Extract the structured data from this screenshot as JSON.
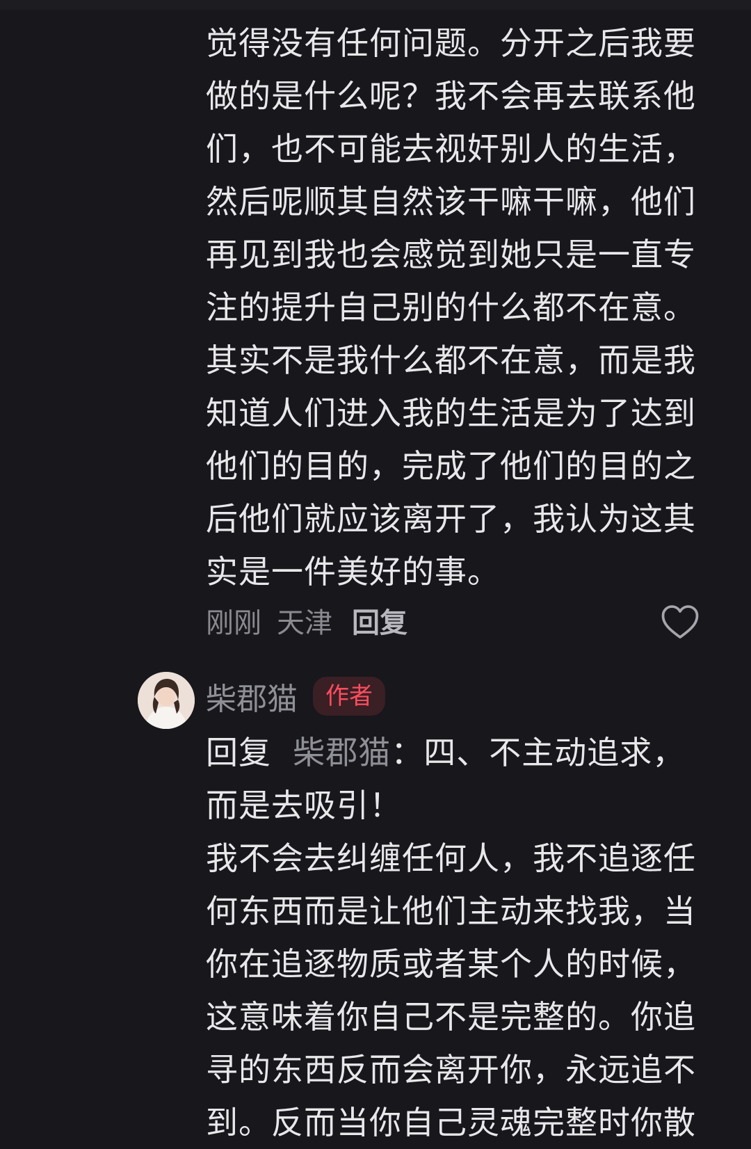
{
  "comment1": {
    "text": "觉得没有任何问题。分开之后我要做的是什么呢？我不会再去联系他们，也不可能去视奸别人的生活，然后呢顺其自然该干嘛干嘛，他们再见到我也会感觉到她只是一直专注的提升自己别的什么都不在意。其实不是我什么都不在意，而是我知道人们进入我的生活是为了达到他们的目的，完成了他们的目的之后他们就应该离开了，我认为这其实是一件美好的事。",
    "time": "刚刚",
    "location": "天津",
    "reply_label": "回复"
  },
  "comment2": {
    "author": "柴郡猫",
    "badge": "作者",
    "reply_prefix": "回复",
    "reply_target": "柴郡猫",
    "reply_colon": "：",
    "text_main": "四、不主动追求，而是去吸引！",
    "text_rest": "我不会去纠缠任何人，我不追逐任何东西而是让他们主动来找我，当你在追逐物质或者某个人的时候，这意味着你自己不是完整的。你追寻的东西反而会离开你，永远追不到。反而当你自己灵魂完整时你散"
  },
  "icons": {
    "like": "heart-outline-icon",
    "avatar": "user-avatar"
  },
  "colors": {
    "background": "#17171c",
    "text": "#e8e8ea",
    "muted": "#8a8a90",
    "badge_bg": "#3a1f24",
    "badge_text": "#ff4d5e"
  }
}
